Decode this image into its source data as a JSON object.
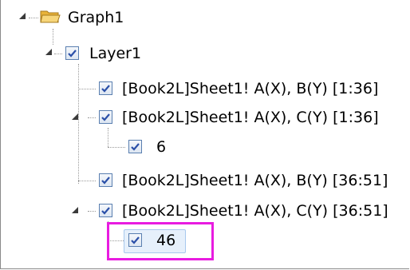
{
  "tree": {
    "graph": {
      "label": "Graph1",
      "icon": "folder-icon"
    },
    "layer": {
      "label": "Layer1"
    },
    "plots": [
      {
        "label": "[Book2L]Sheet1! A(X), B(Y) [1:36]"
      },
      {
        "label": "[Book2L]Sheet1! A(X), C(Y) [1:36]"
      },
      {
        "label": "6"
      },
      {
        "label": "[Book2L]Sheet1! A(X), B(Y) [36:51]"
      },
      {
        "label": "[Book2L]Sheet1! A(X), C(Y) [36:51]"
      },
      {
        "label": "46"
      }
    ]
  },
  "colors": {
    "highlight": "#e81ce0",
    "check": "#2a4fa8",
    "folder": "#f3c24a"
  }
}
